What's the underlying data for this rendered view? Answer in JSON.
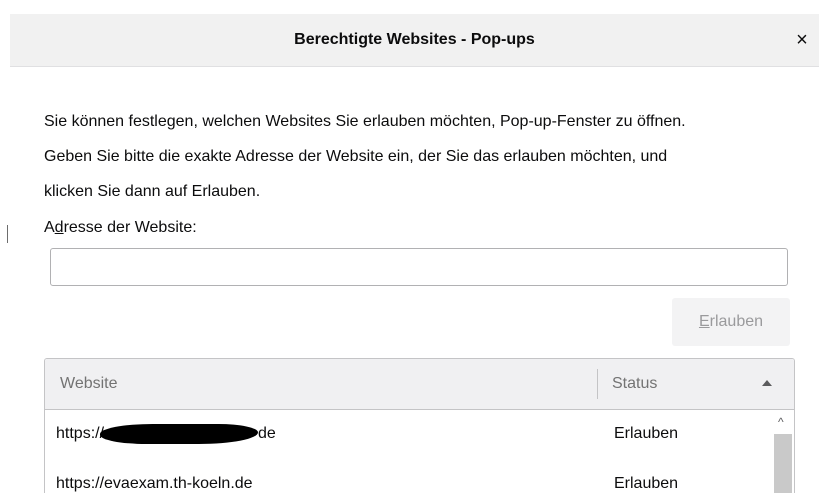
{
  "dialog": {
    "title": "Berechtigte Websites - Pop-ups",
    "close_label": "×"
  },
  "description": {
    "line1": "Sie können festlegen, welchen Websites Sie erlauben möchten, Pop-up-Fenster zu öffnen.",
    "line2": "Geben Sie bitte die exakte Adresse der Website ein, der Sie das erlauben möchten, und",
    "line3": "klicken Sie dann auf Erlauben."
  },
  "address": {
    "label_prefix": "A",
    "label_accesskey": "d",
    "label_rest": "resse der Website:",
    "value": "",
    "placeholder": ""
  },
  "allow_button": {
    "accesskey": "E",
    "rest": "rlauben",
    "enabled": false
  },
  "table": {
    "columns": {
      "website": "Website",
      "status": "Status"
    },
    "sort_icon": "triangle-up-icon",
    "rows": [
      {
        "site_prefix": "https://",
        "site_suffix": "de",
        "redacted": true,
        "status": "Erlauben"
      },
      {
        "site": "https://evaexam.th-koeln.de",
        "status": "Erlauben"
      }
    ]
  },
  "scrollbar": {
    "up_arrow": "^"
  },
  "colors": {
    "titlebar_bg": "#f1f1f1",
    "header_bg": "#f0f0f2",
    "disabled_text": "#9a9a9c",
    "text": "#0c0c0d"
  }
}
